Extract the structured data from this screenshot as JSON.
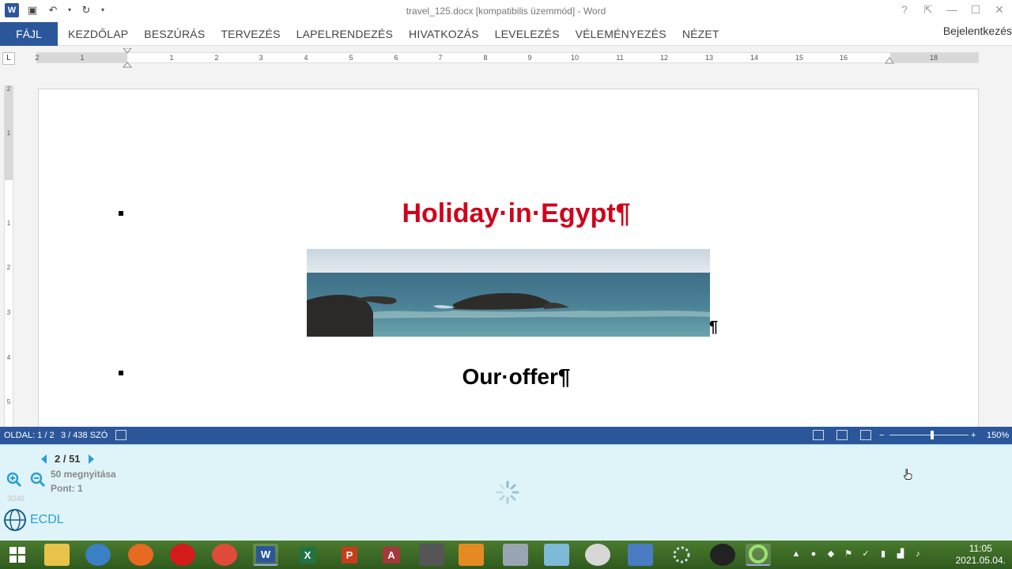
{
  "window": {
    "title": "travel_125.docx [kompatibilis üzemmód] - Word",
    "signin": "Bejelentkezés",
    "help": "?"
  },
  "ribbon": {
    "file_tab": "FÁJL",
    "tabs": [
      "KEZDŐLAP",
      "BESZÚRÁS",
      "TERVEZÉS",
      "LAPELRENDEZÉS",
      "HIVATKOZÁS",
      "LEVELEZÉS",
      "VÉLEMÉNYEZÉS",
      "NÉZET"
    ]
  },
  "ruler": {
    "corner": "L",
    "numbers": [
      "2",
      "1",
      "1",
      "2",
      "3",
      "4",
      "5",
      "6",
      "7",
      "8",
      "9",
      "10",
      "11",
      "12",
      "13",
      "14",
      "15",
      "16",
      "18"
    ],
    "vnumbers": [
      "2",
      "1",
      "1",
      "2",
      "3",
      "4",
      "5"
    ]
  },
  "document": {
    "heading": "Holiday·in·Egypt¶",
    "image_pilcrow": "¶",
    "subheading": "Our·offer¶"
  },
  "status": {
    "page": "OLDAL: 1 / 2",
    "words": "3 / 438 SZÓ",
    "zoom": "150%",
    "zoom_minus": "−",
    "zoom_plus": "+"
  },
  "panel": {
    "counter": "2 / 51",
    "opens": "50 megnyitása",
    "points": "Pont: 1",
    "faint_number": "3046",
    "brand": "ECDL"
  },
  "taskbar": {
    "time": "11:05",
    "date": "2021.05.04."
  },
  "colors": {
    "word_blue": "#2b579a",
    "heading_red": "#d0021b",
    "panel_bg": "#dff4f9",
    "accent": "#2a9fd6"
  }
}
